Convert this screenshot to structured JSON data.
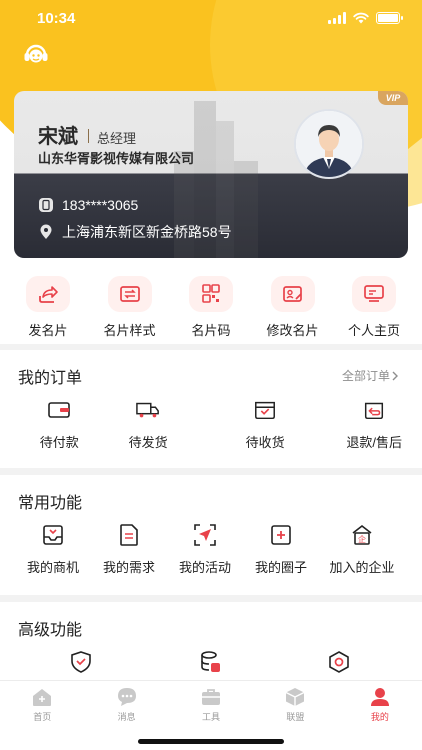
{
  "status": {
    "time": "10:34"
  },
  "card": {
    "vip": "VIP",
    "name": "宋斌",
    "title": "总经理",
    "company": "山东华胥影视传媒有限公司",
    "phone": "183****3065",
    "address": "上海浦东新区新金桥路58号"
  },
  "quick_actions": [
    {
      "label": "发名片",
      "icon": "share-icon"
    },
    {
      "label": "名片样式",
      "icon": "card-style-icon"
    },
    {
      "label": "名片码",
      "icon": "qrcode-icon"
    },
    {
      "label": "修改名片",
      "icon": "edit-card-icon"
    },
    {
      "label": "个人主页",
      "icon": "homepage-icon"
    }
  ],
  "orders": {
    "title": "我的订单",
    "more": "全部订单",
    "items": [
      {
        "label": "待付款",
        "icon": "wallet-icon"
      },
      {
        "label": "待发货",
        "icon": "truck-icon"
      },
      {
        "label": "待收货",
        "icon": "box-icon"
      },
      {
        "label": "退款/售后",
        "icon": "return-icon"
      }
    ]
  },
  "common": {
    "title": "常用功能",
    "items": [
      {
        "label": "我的商机",
        "icon": "inbox-icon"
      },
      {
        "label": "我的需求",
        "icon": "document-icon"
      },
      {
        "label": "我的活动",
        "icon": "send-icon"
      },
      {
        "label": "我的圈子",
        "icon": "plus-square-icon"
      },
      {
        "label": "加入的企业",
        "icon": "enterprise-icon"
      }
    ]
  },
  "advanced": {
    "title": "高级功能",
    "items": [
      {
        "icon": "shield-icon"
      },
      {
        "icon": "database-icon"
      },
      {
        "icon": "hexagon-icon"
      }
    ]
  },
  "tabbar": [
    {
      "label": "首页",
      "icon": "home-icon"
    },
    {
      "label": "消息",
      "icon": "message-icon"
    },
    {
      "label": "工具",
      "icon": "toolbox-icon"
    },
    {
      "label": "联盟",
      "icon": "cube-icon"
    },
    {
      "label": "我的",
      "icon": "user-icon"
    }
  ],
  "colors": {
    "accent": "#e8424a",
    "brand_yellow": "#fac21f",
    "card_dark": "#2a2c35"
  }
}
